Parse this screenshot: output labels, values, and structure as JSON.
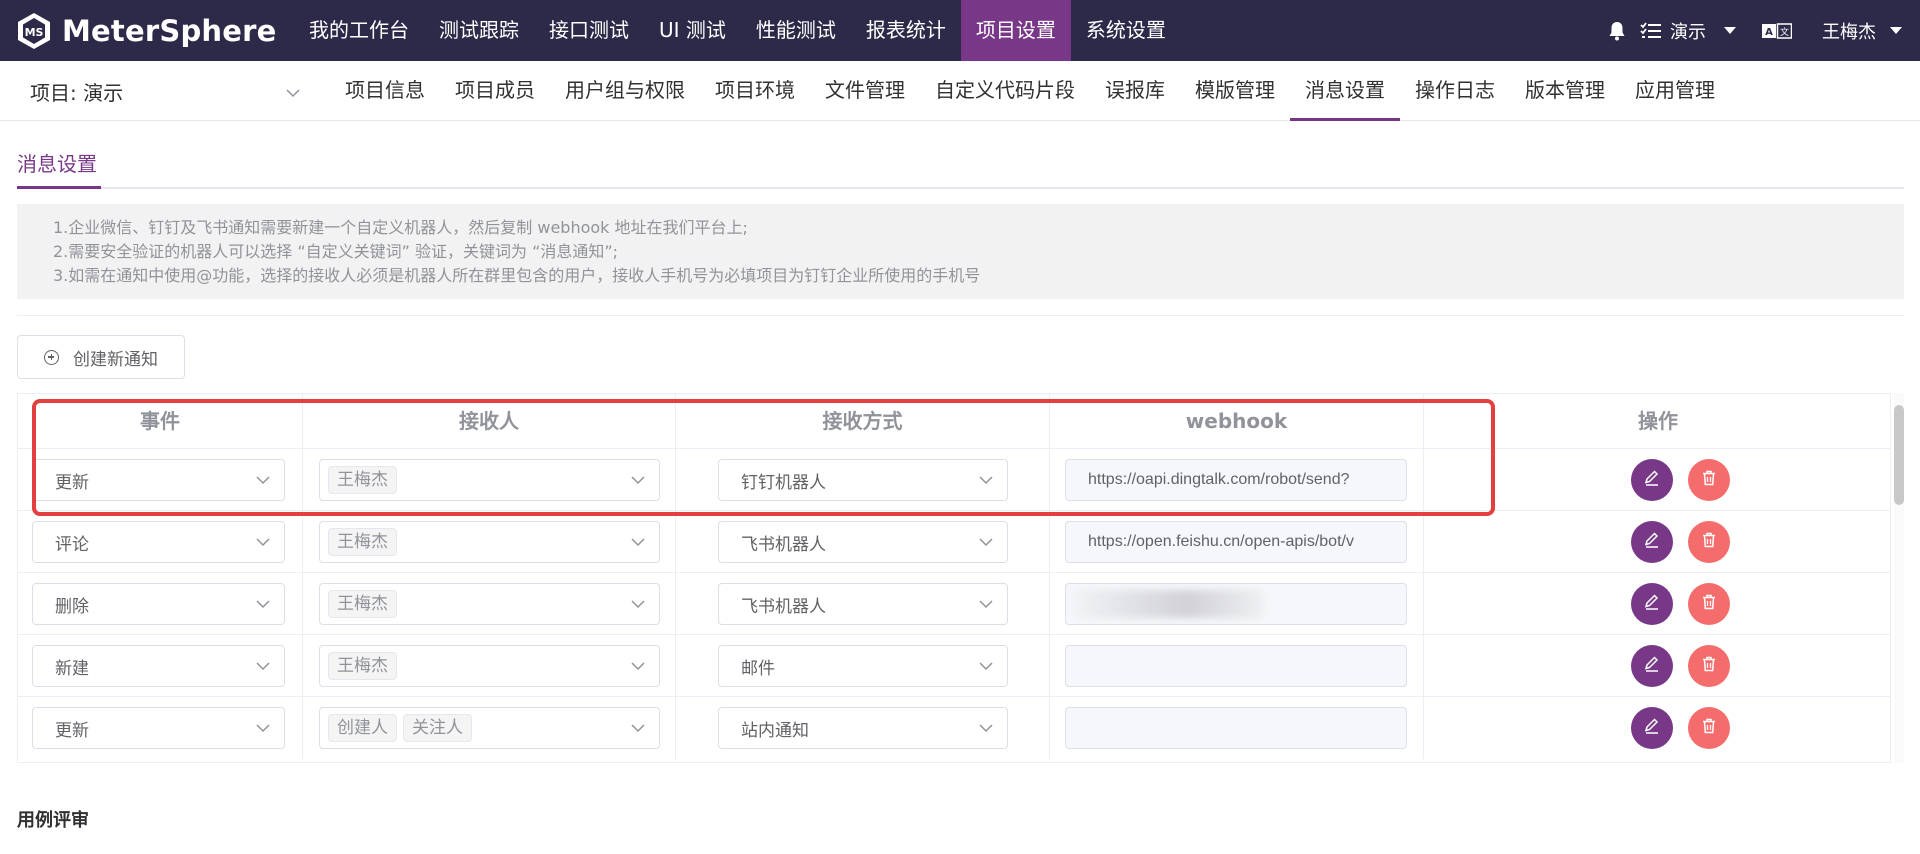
{
  "app": {
    "brand": "MeterSphere",
    "accent": "#783887",
    "topbar_bg": "#2c2a48"
  },
  "topnav": {
    "items": [
      "我的工作台",
      "测试跟踪",
      "接口测试",
      "UI 测试",
      "性能测试",
      "报表统计",
      "项目设置",
      "系统设置"
    ],
    "active": "项目设置"
  },
  "topright": {
    "workspace": "演示",
    "user": "王梅杰",
    "icons": [
      "bell-icon",
      "task-list-icon",
      "language-icon"
    ]
  },
  "project": {
    "label": "项目: 演示"
  },
  "subnav": {
    "items": [
      "项目信息",
      "项目成员",
      "用户组与权限",
      "项目环境",
      "文件管理",
      "自定义代码片段",
      "误报库",
      "模版管理",
      "消息设置",
      "操作日志",
      "版本管理",
      "应用管理"
    ],
    "active": "消息设置"
  },
  "page": {
    "tab": "消息设置",
    "tips": [
      "1.企业微信、钉钉及飞书通知需要新建一个自定义机器人，然后复制 webhook 地址在我们平台上;",
      "2.需要安全验证的机器人可以选择 “自定义关键词” 验证，关键词为 “消息通知”;",
      "3.如需在通知中使用@功能，选择的接收人必须是机器人所在群里包含的用户，接收人手机号为必填项目为钉钉企业所使用的手机号"
    ],
    "create_button": "创建新通知",
    "next_section": "用例评审"
  },
  "table": {
    "headers": [
      "事件",
      "接收人",
      "接收方式",
      "webhook",
      "操作"
    ],
    "rows": [
      {
        "event": "更新",
        "receivers": [
          "王梅杰"
        ],
        "method": "钉钉机器人",
        "webhook": "https://oapi.dingtalk.com/robot/send?",
        "webhook_blurred": false
      },
      {
        "event": "评论",
        "receivers": [
          "王梅杰"
        ],
        "method": "飞书机器人",
        "webhook": "https://open.feishu.cn/open-apis/bot/v",
        "webhook_blurred": false
      },
      {
        "event": "删除",
        "receivers": [
          "王梅杰"
        ],
        "method": "飞书机器人",
        "webhook": "",
        "webhook_blurred": true
      },
      {
        "event": "新建",
        "receivers": [
          "王梅杰"
        ],
        "method": "邮件",
        "webhook": "",
        "webhook_blurred": false
      },
      {
        "event": "更新",
        "receivers": [
          "创建人",
          "关注人"
        ],
        "method": "站内通知",
        "webhook": "",
        "webhook_blurred": false
      }
    ],
    "action_icons": [
      "edit-icon",
      "delete-icon"
    ]
  }
}
